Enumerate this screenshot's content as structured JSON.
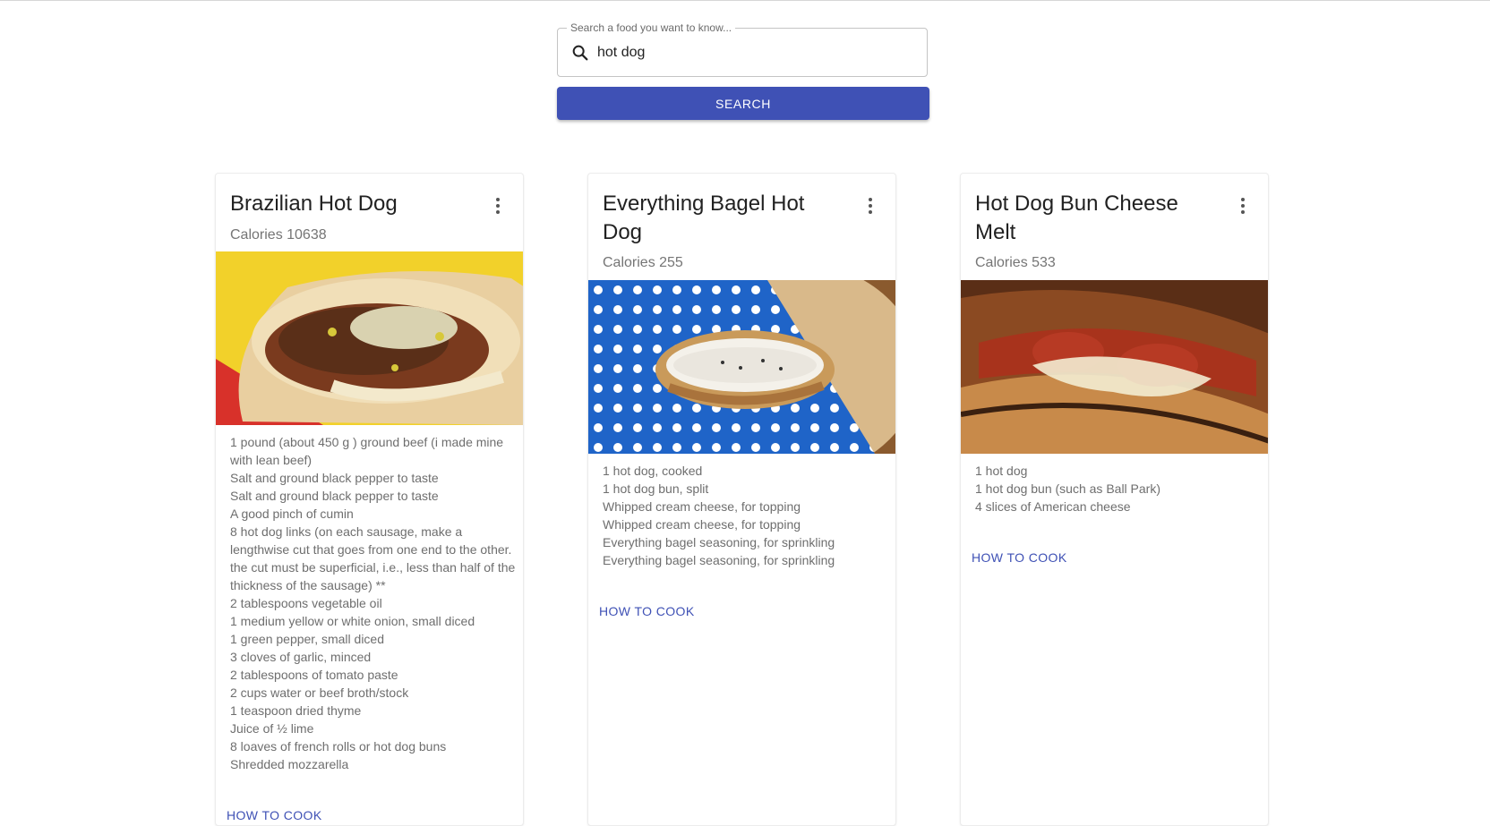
{
  "search": {
    "label": "Search a food you want to know...",
    "value": "hot dog",
    "button_label": "SEARCH"
  },
  "colors": {
    "accent": "#3f51b5"
  },
  "cards": [
    {
      "title": "Brazilian Hot Dog",
      "calories": "Calories 10638",
      "ingredients": [
        "1 pound (about 450 g ) ground beef (i made mine with lean beef)",
        "Salt and ground black pepper to taste",
        "Salt and ground black pepper to taste",
        "A good pinch of cumin",
        "8 hot dog links (on each sausage, make a lengthwise cut that goes from one end to the other. the cut must be superficial, i.e., less than half of the thickness of the sausage) **",
        "2 tablespoons vegetable oil",
        "1 medium yellow or white onion, small diced",
        "1 green pepper, small diced",
        "3 cloves of garlic, minced",
        "2 tablespoons of tomato paste",
        "2 cups water or beef broth/stock",
        "1 teaspoon dried thyme",
        "Juice of ½ lime",
        "8 loaves of french rolls or hot dog buns",
        "Shredded mozzarella"
      ],
      "link": "HOW TO COOK"
    },
    {
      "title": "Everything Bagel Hot Dog",
      "calories": "Calories 255",
      "ingredients": [
        "1 hot dog, cooked",
        "1 hot dog bun, split",
        "Whipped cream cheese, for topping",
        "Whipped cream cheese, for topping",
        "Everything bagel seasoning, for sprinkling",
        "Everything bagel seasoning, for sprinkling"
      ],
      "link": "HOW TO COOK"
    },
    {
      "title": "Hot Dog Bun Cheese Melt",
      "calories": "Calories 533",
      "ingredients": [
        "1 hot dog",
        "1 hot dog bun (such as Ball Park)",
        "4 slices of American cheese"
      ],
      "link": "HOW TO COOK"
    }
  ]
}
